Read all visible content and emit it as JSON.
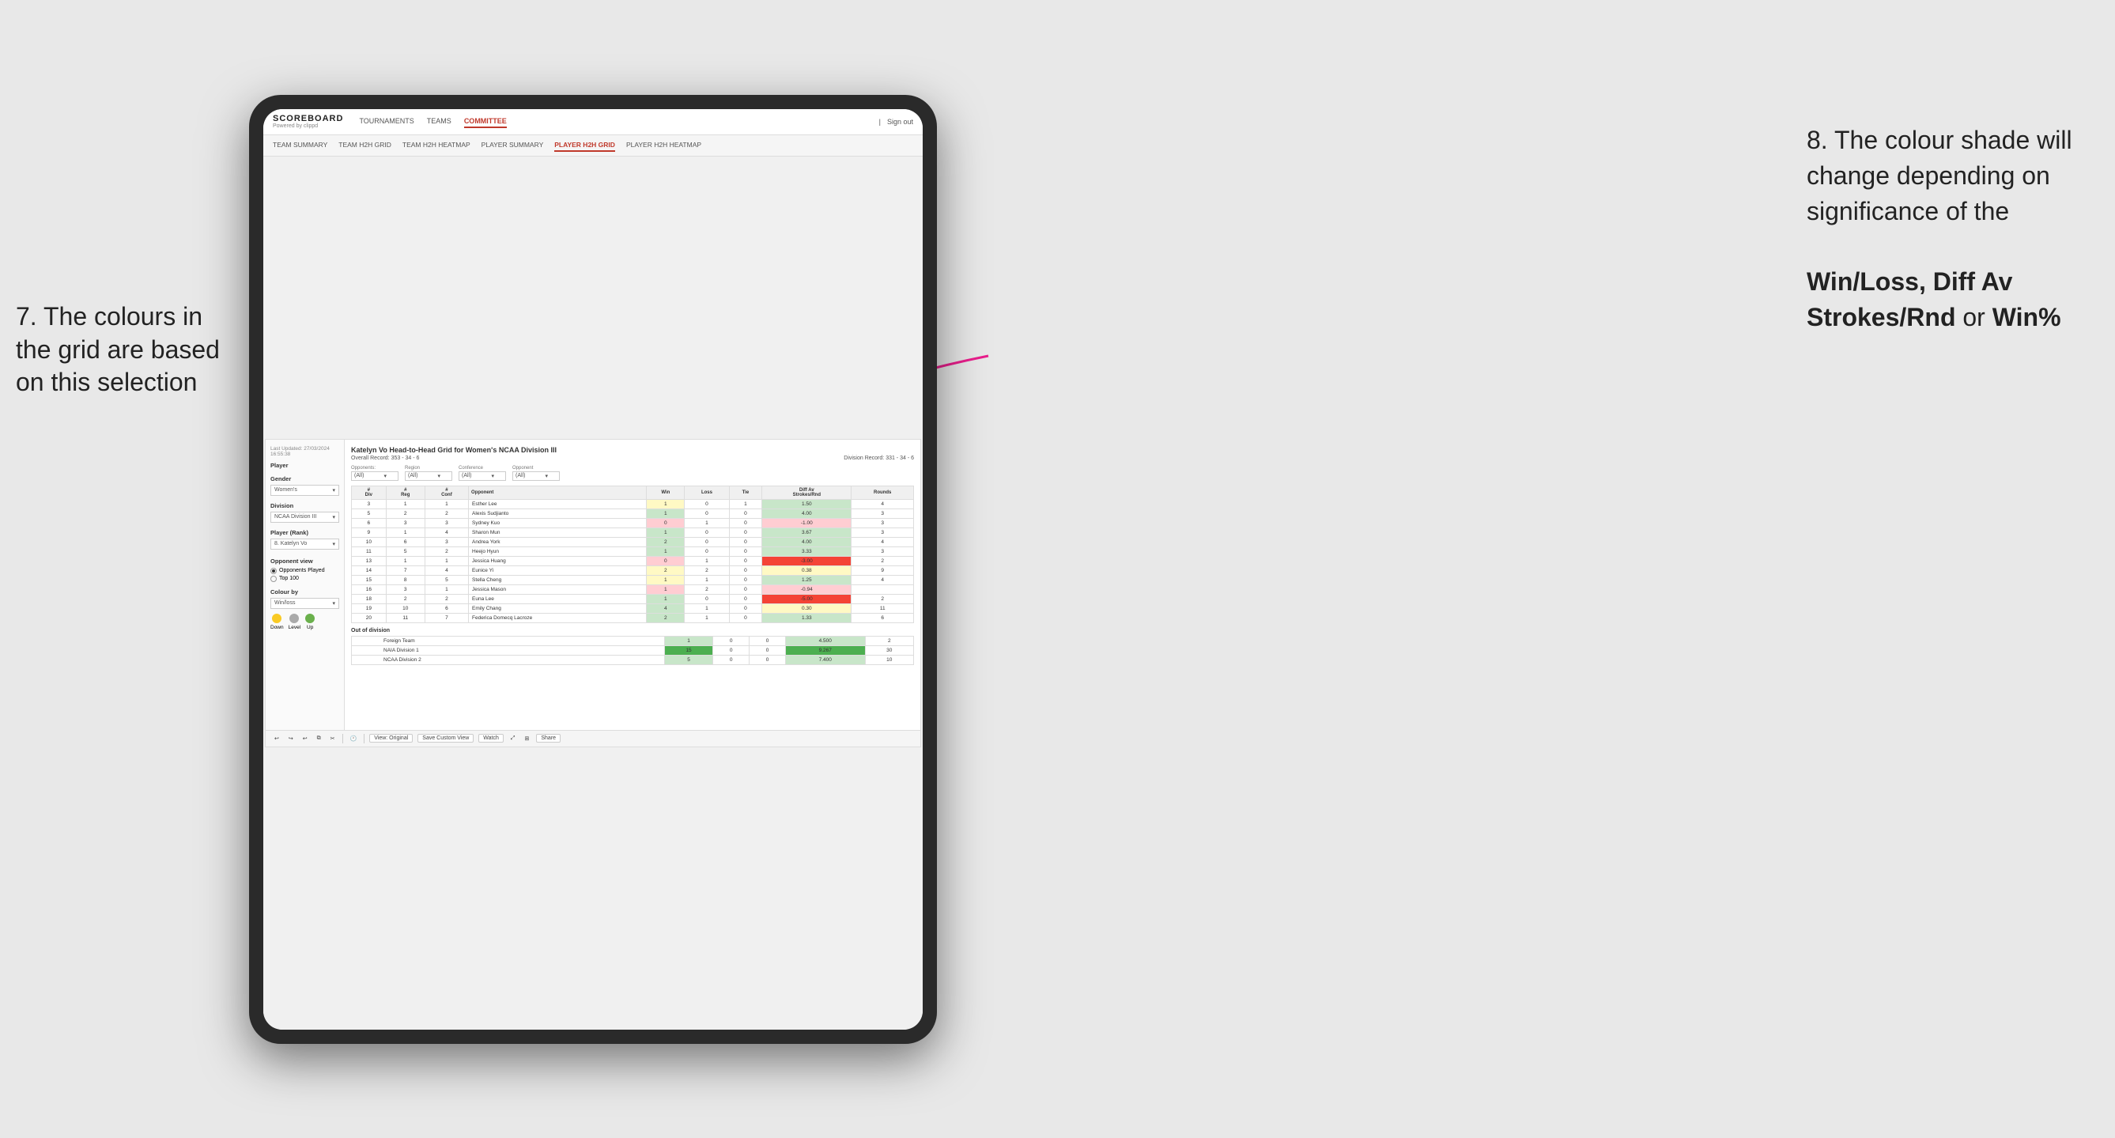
{
  "annotations": {
    "left_title": "7. The colours in the grid are based on this selection",
    "right_title": "8. The colour shade will change depending on significance of the",
    "right_bold1": "Win/Loss, Diff Av Strokes/Rnd",
    "right_or": "or",
    "right_bold2": "Win%"
  },
  "nav": {
    "logo": "SCOREBOARD",
    "logo_sub": "Powered by clippd",
    "items": [
      "TOURNAMENTS",
      "TEAMS",
      "COMMITTEE"
    ],
    "active": "COMMITTEE",
    "right": "Sign out"
  },
  "subnav": {
    "items": [
      "TEAM SUMMARY",
      "TEAM H2H GRID",
      "TEAM H2H HEATMAP",
      "PLAYER SUMMARY",
      "PLAYER H2H GRID",
      "PLAYER H2H HEATMAP"
    ],
    "active": "PLAYER H2H GRID"
  },
  "sidebar": {
    "last_updated": "Last Updated: 27/03/2024 16:55:38",
    "player_label": "Player",
    "gender_label": "Gender",
    "gender_value": "Women's",
    "division_label": "Division",
    "division_value": "NCAA Division III",
    "player_rank_label": "Player (Rank)",
    "player_rank_value": "8. Katelyn Vo",
    "opponent_view_label": "Opponent view",
    "radio_opponents": "Opponents Played",
    "radio_top100": "Top 100",
    "colour_by_label": "Colour by",
    "colour_by_value": "Win/loss",
    "legend": [
      {
        "label": "Down",
        "color": "#f9ca24"
      },
      {
        "label": "Level",
        "color": "#aaa"
      },
      {
        "label": "Up",
        "color": "#6ab04c"
      }
    ]
  },
  "grid": {
    "title": "Katelyn Vo Head-to-Head Grid for Women's NCAA Division III",
    "overall_record_label": "Overall Record:",
    "overall_record_value": "353 - 34 - 6",
    "division_record_label": "Division Record:",
    "division_record_value": "331 - 34 - 6",
    "opponents_label": "Opponents:",
    "opponents_value": "(All)",
    "region_label": "Region",
    "region_value": "(All)",
    "conference_label": "Conference",
    "conference_value": "(All)",
    "opponent_label": "Opponent",
    "opponent_value": "(All)",
    "columns": [
      "#\nDiv",
      "#\nReg",
      "#\nConf",
      "Opponent",
      "Win",
      "Loss",
      "Tie",
      "Diff Av\nStrokes/Rnd",
      "Rounds"
    ],
    "rows": [
      {
        "div": "3",
        "reg": "1",
        "conf": "1",
        "opponent": "Esther Lee",
        "win": "1",
        "loss": "0",
        "tie": "1",
        "diff": "1.50",
        "rounds": "4",
        "win_color": "yellow",
        "diff_color": "light_green"
      },
      {
        "div": "5",
        "reg": "2",
        "conf": "2",
        "opponent": "Alexis Sudjianto",
        "win": "1",
        "loss": "0",
        "tie": "0",
        "diff": "4.00",
        "rounds": "3",
        "win_color": "green",
        "diff_color": "green"
      },
      {
        "div": "6",
        "reg": "3",
        "conf": "3",
        "opponent": "Sydney Kuo",
        "win": "0",
        "loss": "1",
        "tie": "0",
        "diff": "-1.00",
        "rounds": "3",
        "win_color": "red",
        "diff_color": "light_red"
      },
      {
        "div": "9",
        "reg": "1",
        "conf": "4",
        "opponent": "Sharon Mun",
        "win": "1",
        "loss": "0",
        "tie": "0",
        "diff": "3.67",
        "rounds": "3",
        "win_color": "green",
        "diff_color": "green"
      },
      {
        "div": "10",
        "reg": "6",
        "conf": "3",
        "opponent": "Andrea York",
        "win": "2",
        "loss": "0",
        "tie": "0",
        "diff": "4.00",
        "rounds": "4",
        "win_color": "green",
        "diff_color": "green"
      },
      {
        "div": "11",
        "reg": "5",
        "conf": "2",
        "opponent": "Heejo Hyun",
        "win": "1",
        "loss": "0",
        "tie": "0",
        "diff": "3.33",
        "rounds": "3",
        "win_color": "green",
        "diff_color": "green"
      },
      {
        "div": "13",
        "reg": "1",
        "conf": "1",
        "opponent": "Jessica Huang",
        "win": "0",
        "loss": "1",
        "tie": "0",
        "diff": "-3.00",
        "rounds": "2",
        "win_color": "red",
        "diff_color": "red"
      },
      {
        "div": "14",
        "reg": "7",
        "conf": "4",
        "opponent": "Eunice Yi",
        "win": "2",
        "loss": "2",
        "tie": "0",
        "diff": "0.38",
        "rounds": "9",
        "win_color": "yellow",
        "diff_color": "yellow"
      },
      {
        "div": "15",
        "reg": "8",
        "conf": "5",
        "opponent": "Stella Cheng",
        "win": "1",
        "loss": "1",
        "tie": "0",
        "diff": "1.25",
        "rounds": "4",
        "win_color": "yellow",
        "diff_color": "light_green"
      },
      {
        "div": "16",
        "reg": "3",
        "conf": "1",
        "opponent": "Jessica Mason",
        "win": "1",
        "loss": "2",
        "tie": "0",
        "diff": "-0.94",
        "rounds": "",
        "win_color": "light_red",
        "diff_color": "light_red"
      },
      {
        "div": "18",
        "reg": "2",
        "conf": "2",
        "opponent": "Euna Lee",
        "win": "1",
        "loss": "0",
        "tie": "0",
        "diff": "-5.00",
        "rounds": "2",
        "win_color": "green",
        "diff_color": "red"
      },
      {
        "div": "19",
        "reg": "10",
        "conf": "6",
        "opponent": "Emily Chang",
        "win": "4",
        "loss": "1",
        "tie": "0",
        "diff": "0.30",
        "rounds": "11",
        "win_color": "green",
        "diff_color": "yellow"
      },
      {
        "div": "20",
        "reg": "11",
        "conf": "7",
        "opponent": "Federica Domecq Lacroze",
        "win": "2",
        "loss": "1",
        "tie": "0",
        "diff": "1.33",
        "rounds": "6",
        "win_color": "green",
        "diff_color": "light_green"
      }
    ],
    "out_of_division_label": "Out of division",
    "out_of_division_rows": [
      {
        "opponent": "Foreign Team",
        "win": "1",
        "loss": "0",
        "tie": "0",
        "diff": "4.500",
        "rounds": "2",
        "win_color": "green",
        "diff_color": "green"
      },
      {
        "opponent": "NAIA Division 1",
        "win": "15",
        "loss": "0",
        "tie": "0",
        "diff": "9.267",
        "rounds": "30",
        "win_color": "dark_green",
        "diff_color": "dark_green"
      },
      {
        "opponent": "NCAA Division 2",
        "win": "5",
        "loss": "0",
        "tie": "0",
        "diff": "7.400",
        "rounds": "10",
        "win_color": "green",
        "diff_color": "green"
      }
    ]
  },
  "toolbar": {
    "view_original": "View: Original",
    "save_custom_view": "Save Custom View",
    "watch": "Watch",
    "share": "Share"
  }
}
